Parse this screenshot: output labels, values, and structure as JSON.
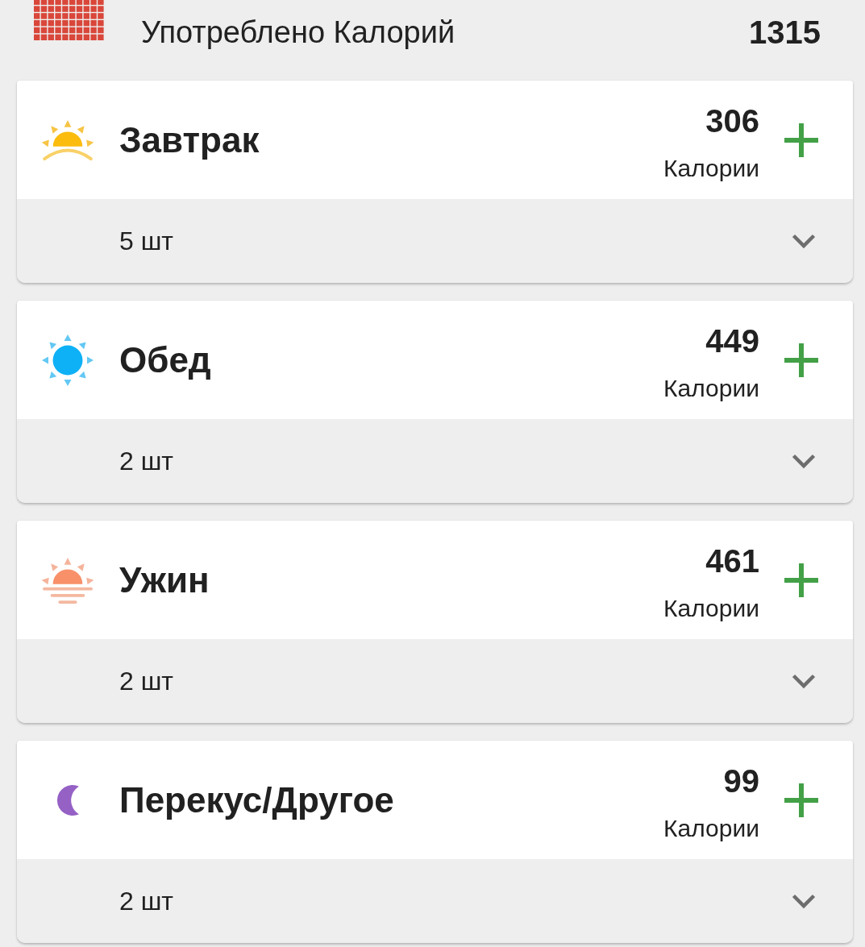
{
  "summary": {
    "label": "Употреблено Калорий",
    "value": "1315"
  },
  "meals": [
    {
      "kind": "sunrise",
      "title": "Завтрак",
      "calories": "306",
      "calories_label": "Калории",
      "count": "5 шт",
      "expanded": false
    },
    {
      "kind": "sun",
      "title": "Обед",
      "calories": "449",
      "calories_label": "Калории",
      "count": "2 шт",
      "expanded": false
    },
    {
      "kind": "sunset",
      "title": "Ужин",
      "calories": "461",
      "calories_label": "Калории",
      "count": "2 шт",
      "expanded": false
    },
    {
      "kind": "moon",
      "title": "Перекус/Другое",
      "calories": "99",
      "calories_label": "Калории",
      "count": "2 шт",
      "expanded": false
    }
  ]
}
